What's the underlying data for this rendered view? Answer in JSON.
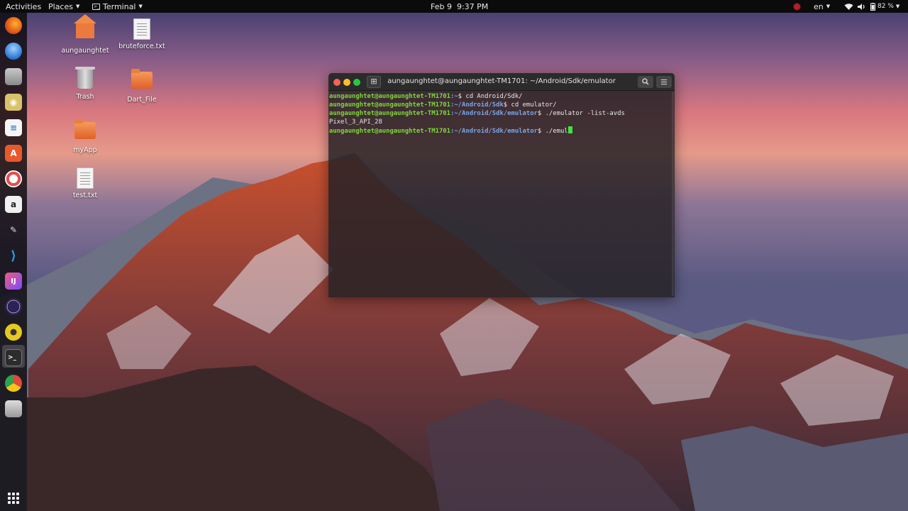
{
  "topbar": {
    "activities": "Activities",
    "places": "Places",
    "app_name": "Terminal",
    "clock": "Feb 9  9:37 PM",
    "language": "en",
    "battery": "82 %"
  },
  "dock": {
    "items": [
      {
        "name": "firefox",
        "color": "#e66000"
      },
      {
        "name": "thunderbird",
        "color": "#2a76d2"
      },
      {
        "name": "files",
        "color": "#8a8a8a"
      },
      {
        "name": "rhythmbox",
        "color": "#d8c36a"
      },
      {
        "name": "libreoffice-writer",
        "color": "#2a7fd4"
      },
      {
        "name": "ubuntu-software",
        "color": "#e9582c"
      },
      {
        "name": "help",
        "color": "#e05050"
      },
      {
        "name": "amazon",
        "color": "#f0f0f0"
      },
      {
        "name": "sublime",
        "color": "#555"
      },
      {
        "name": "vscode",
        "color": "#1f8ad6"
      },
      {
        "name": "intellij",
        "color": "#c8306c"
      },
      {
        "name": "eclipse",
        "color": "#2c2255"
      },
      {
        "name": "disk",
        "color": "#e6c820"
      },
      {
        "name": "terminal",
        "color": "#2c2c2c"
      },
      {
        "name": "chrome",
        "color": "#30a14e"
      },
      {
        "name": "storage",
        "color": "#aaaaaa"
      }
    ]
  },
  "desktop": {
    "icons": [
      {
        "label": "aungaunghtet",
        "type": "home"
      },
      {
        "label": "bruteforce.txt",
        "type": "text"
      },
      {
        "label": "Trash",
        "type": "trash"
      },
      {
        "label": "Dart_File",
        "type": "folder"
      },
      {
        "label": "myApp",
        "type": "folder"
      },
      {
        "label": "test.txt",
        "type": "text"
      }
    ]
  },
  "terminal": {
    "title": "aungaunghtet@aungaunghtet-TM1701: ~/Android/Sdk/emulator",
    "lines": [
      {
        "user": "aungaunghtet@aungaunghtet-TM1701",
        "path": ":~",
        "cmd": "$ cd Android/Sdk/"
      },
      {
        "user": "aungaunghtet@aungaunghtet-TM1701",
        "path": ":~/Android/Sdk",
        "cmd": "$ cd emulator/"
      },
      {
        "user": "aungaunghtet@aungaunghtet-TM1701",
        "path": ":~/Android/Sdk/emulator",
        "cmd": "$ ./emulator -list-avds"
      },
      {
        "output": "Pixel_3_API_28"
      },
      {
        "user": "aungaunghtet@aungaunghtet-TM1701",
        "path": ":~/Android/Sdk/emulator",
        "cmd": "$ ./emul"
      }
    ]
  }
}
